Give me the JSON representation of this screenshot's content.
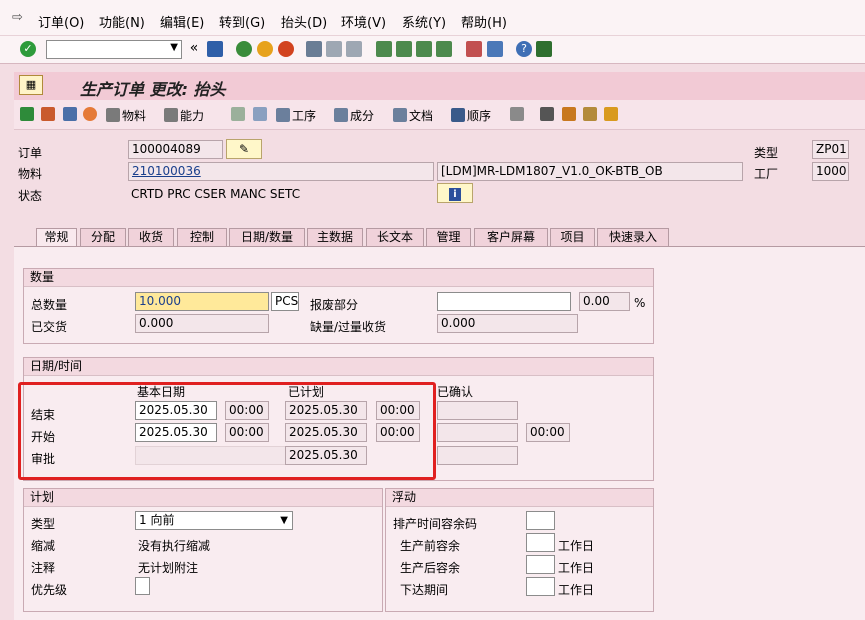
{
  "menu": {
    "items": [
      "订单(O)",
      "功能(N)",
      "编辑(E)",
      "转到(G)",
      "抬头(D)",
      "环境(V)",
      "系统(Y)",
      "帮助(H)"
    ]
  },
  "toolbar": {
    "command_value": "",
    "chevron": "«"
  },
  "title": {
    "text": "生产订单 更改: 抬头"
  },
  "app_toolbar": {
    "material_label": "物料",
    "capacity_label": "能力",
    "operations_label": "工序",
    "components_label": "成分",
    "documents_label": "文档",
    "sequences_label": "顺序"
  },
  "header": {
    "order_label": "订单",
    "order_value": "100004089",
    "material_label": "物料",
    "material_value": "210100036",
    "material_desc": "[LDM]MR-LDM1807_V1.0_OK-BTB_OB",
    "status_label": "状态",
    "status_value": "CRTD PRC  CSER MANC SETC",
    "type_label": "类型",
    "type_value": "ZP01",
    "plant_label": "工厂",
    "plant_value": "1000"
  },
  "tabs": [
    "常规",
    "分配",
    "收货",
    "控制",
    "日期/数量",
    "主数据",
    "长文本",
    "管理",
    "客户屏幕",
    "项目",
    "快速录入"
  ],
  "quantities": {
    "title": "数量",
    "total_label": "总数量",
    "total_value": "10.000",
    "unit": "PCS",
    "scrap_label": "报废部分",
    "scrap_value": "",
    "scrap_pct": "0.00",
    "pct_sign": "%",
    "delivered_label": "已交货",
    "delivered_value": "0.000",
    "short_label": "缺量/过量收货",
    "short_value": "0.000"
  },
  "dates": {
    "title": "日期/时间",
    "basic_header": "基本日期",
    "scheduled_header": "已计划",
    "confirmed_header": "已确认",
    "end_label": "结束",
    "end_basic_date": "2025.05.30",
    "end_basic_time": "00:00",
    "end_sched_date": "2025.05.30",
    "end_sched_time": "00:00",
    "start_label": "开始",
    "start_basic_date": "2025.05.30",
    "start_basic_time": "00:00",
    "start_sched_date": "2025.05.30",
    "start_sched_time": "00:00",
    "start_conf_time": "00:00",
    "release_label": "审批",
    "release_sched_date": "2025.05.30"
  },
  "planning": {
    "title": "计划",
    "type_label": "类型",
    "type_value": "1 向前",
    "reduction_label": "缩减",
    "reduction_value": "没有执行缩减",
    "note_label": "注释",
    "note_value": "无计划附注",
    "priority_label": "优先级"
  },
  "floats": {
    "title": "浮动",
    "sched_margin_label": "排产时间容余码",
    "before_label": "生产前容余",
    "after_label": "生产后容余",
    "release_label": "下达期间",
    "workdays": "工作日"
  }
}
